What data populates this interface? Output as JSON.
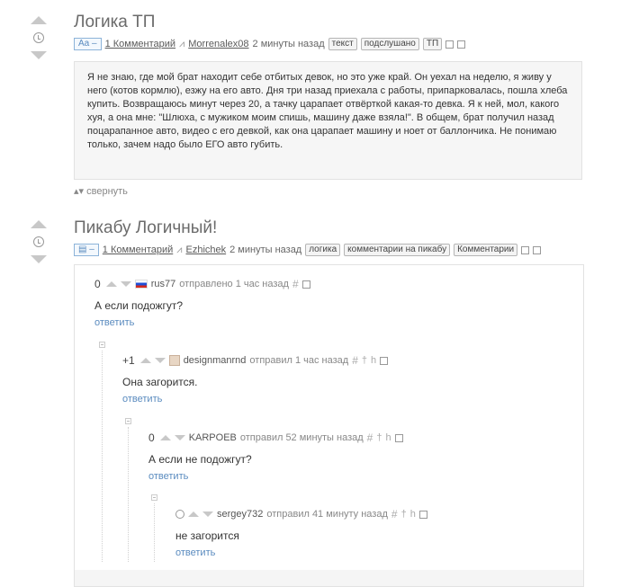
{
  "post1": {
    "title": "Логика ТП",
    "badge": "Aa –",
    "comments": "1 Комментарий",
    "author": "Morrenalex08",
    "time": "2 минуты назад",
    "tags": [
      "текст",
      "подслушано",
      "ТП"
    ],
    "story": "Я не знаю, где мой брат находит себе отбитых девок, но это уже край. Он уехал на неделю, я живу у него (котов кормлю), езжу на его авто. Дня три назад приехала с работы, припарковалась, пошла хлеба купить. Возвращаюсь минут через 20, а тачку царапает отвёрткой какая-то девка. Я к ней, мол, какого хуя, а она мне: \"Шлюха, с мужиком моим спишь, машину даже взяла!\". В общем, брат получил назад поцарапанное авто, видео с его девкой, как она царапает машину и ноет от баллончика. Не понимаю только, зачем надо было ЕГО авто губить.",
    "collapse": "свернуть"
  },
  "post2": {
    "title": "Пикабу Логичный!",
    "comments": "1 Комментарий",
    "author": "Ezhichek",
    "time": "2 минуты назад",
    "tags": [
      "логика",
      "комментарии на пикабу",
      "Комментарии"
    ]
  },
  "comments": [
    {
      "score": "0",
      "user": "rus77",
      "action": "отправлено 1 час назад",
      "text": "А если подожгут?",
      "reply": "ответить"
    },
    {
      "score": "+1",
      "user": "designmanrnd",
      "action": "отправил 1 час назад",
      "text": "Она загорится.",
      "reply": "ответить"
    },
    {
      "score": "0",
      "user": "KARPOEB",
      "action": "отправил 52 минуты назад",
      "text": "А если не подожгут?",
      "reply": "ответить"
    },
    {
      "score": "",
      "user": "sergey732",
      "action": "отправил 41 минуту назад",
      "text": "не загорится",
      "reply": "ответить"
    }
  ]
}
